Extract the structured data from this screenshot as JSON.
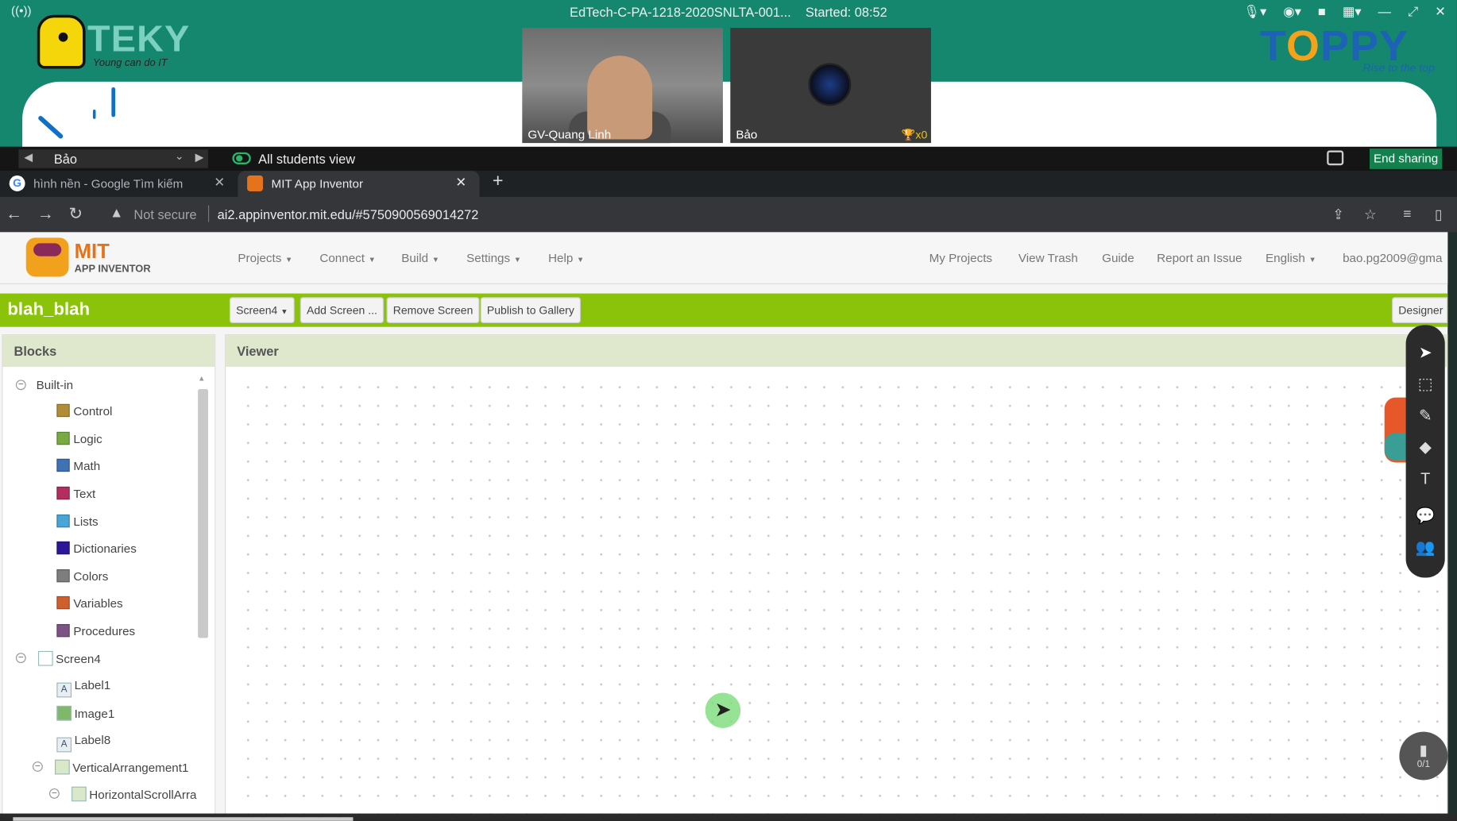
{
  "meeting": {
    "title": "EdTech-C-PA-1218-2020SNLTA-001...",
    "started": "Started: 08:52",
    "brand_left": {
      "word": "TEKY",
      "tagline": "Young can do IT"
    },
    "brand_right": {
      "word_part1": "T",
      "word_part2": "O",
      "word_part3": "PPY",
      "tagline": "Rise to the top"
    },
    "participants": [
      {
        "name": "GV-Quang Linh"
      },
      {
        "name": "Bảo",
        "badge": "x0"
      }
    ],
    "student_select": "Bảo",
    "view_label": "All students view",
    "end_sharing": "End sharing"
  },
  "browser": {
    "tabs": [
      {
        "title": "hình nền - Google Tìm kiếm",
        "icon": "google-icon"
      },
      {
        "title": "MIT App Inventor",
        "icon": "app-inventor-icon",
        "active": true
      }
    ],
    "security": "Not secure",
    "url": "ai2.appinventor.mit.edu/#5750900569014272"
  },
  "appinventor": {
    "logo": {
      "mit": "MIT",
      "sub": "APP INVENTOR"
    },
    "menu": {
      "projects": "Projects",
      "connect": "Connect",
      "build": "Build",
      "settings": "Settings",
      "help": "Help",
      "my_projects": "My Projects",
      "view_trash": "View Trash",
      "guide": "Guide",
      "report": "Report an Issue",
      "language": "English",
      "account": "bao.pg2009@gma"
    },
    "project_name": "blah_blah",
    "toolbar": {
      "screen": "Screen4",
      "add_screen": "Add Screen ...",
      "remove_screen": "Remove Screen",
      "publish": "Publish to Gallery",
      "designer": "Designer"
    },
    "blocks": {
      "header": "Blocks",
      "builtin_label": "Built-in",
      "builtin": [
        {
          "label": "Control",
          "color": "#b18e35"
        },
        {
          "label": "Logic",
          "color": "#77ab41"
        },
        {
          "label": "Math",
          "color": "#3f71b5"
        },
        {
          "label": "Text",
          "color": "#b32d5e"
        },
        {
          "label": "Lists",
          "color": "#49a6d4"
        },
        {
          "label": "Dictionaries",
          "color": "#2d1799"
        },
        {
          "label": "Colors",
          "color": "#7d7d7d"
        },
        {
          "label": "Variables",
          "color": "#d05f2d"
        },
        {
          "label": "Procedures",
          "color": "#7c5385"
        }
      ],
      "screen_label": "Screen4",
      "components": [
        {
          "label": "Label1",
          "icon": "label-icon"
        },
        {
          "label": "Image1",
          "icon": "image-icon"
        },
        {
          "label": "Label8",
          "icon": "label-icon"
        },
        {
          "label": "VerticalArrangement1",
          "icon": "arrangement-icon"
        },
        {
          "label": "HorizontalScrollArra",
          "icon": "arrangement-icon"
        }
      ]
    },
    "viewer": {
      "header": "Viewer"
    },
    "fab_label": "0/1"
  }
}
